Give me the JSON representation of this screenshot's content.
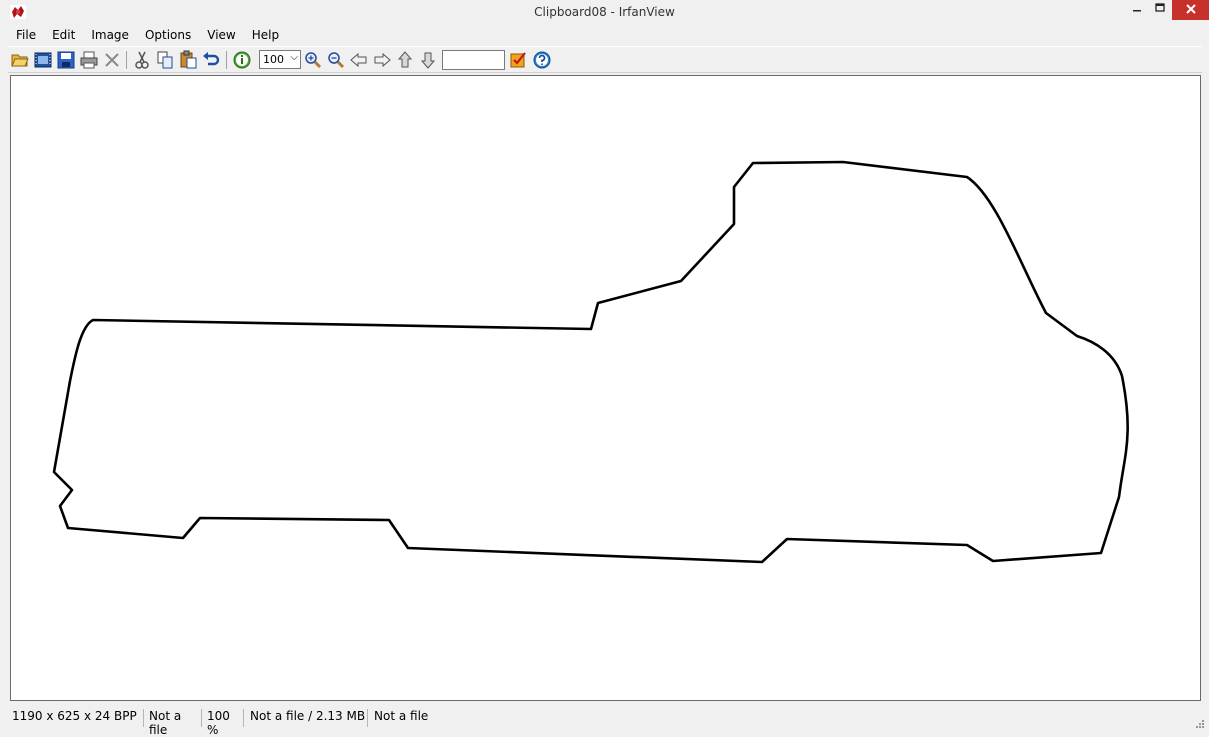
{
  "window": {
    "title": "Clipboard08 - IrfanView"
  },
  "menu": {
    "items": [
      "File",
      "Edit",
      "Image",
      "Options",
      "View",
      "Help"
    ]
  },
  "toolbar": {
    "zoom_value": "100",
    "page_input_value": "",
    "icons": [
      "open-folder-icon",
      "slideshow-icon",
      "save-icon",
      "print-icon",
      "delete-icon",
      "cut-icon",
      "copy-icon",
      "paste-icon",
      "undo-icon",
      "info-icon",
      "zoom-in-icon",
      "zoom-out-icon",
      "previous-icon",
      "next-icon",
      "first-icon",
      "last-icon",
      "checklist-icon",
      "help-icon"
    ]
  },
  "status": {
    "dimensions": "1190 x 625 x 24 BPP",
    "file_index": "Not a file",
    "zoom": "100 %",
    "size": "Not a file / 2.13 MB",
    "date": "Not a file"
  },
  "colors": {
    "close_button": "#c7312b",
    "canvas_background": "#ffffff",
    "shape_stroke": "#000000"
  }
}
